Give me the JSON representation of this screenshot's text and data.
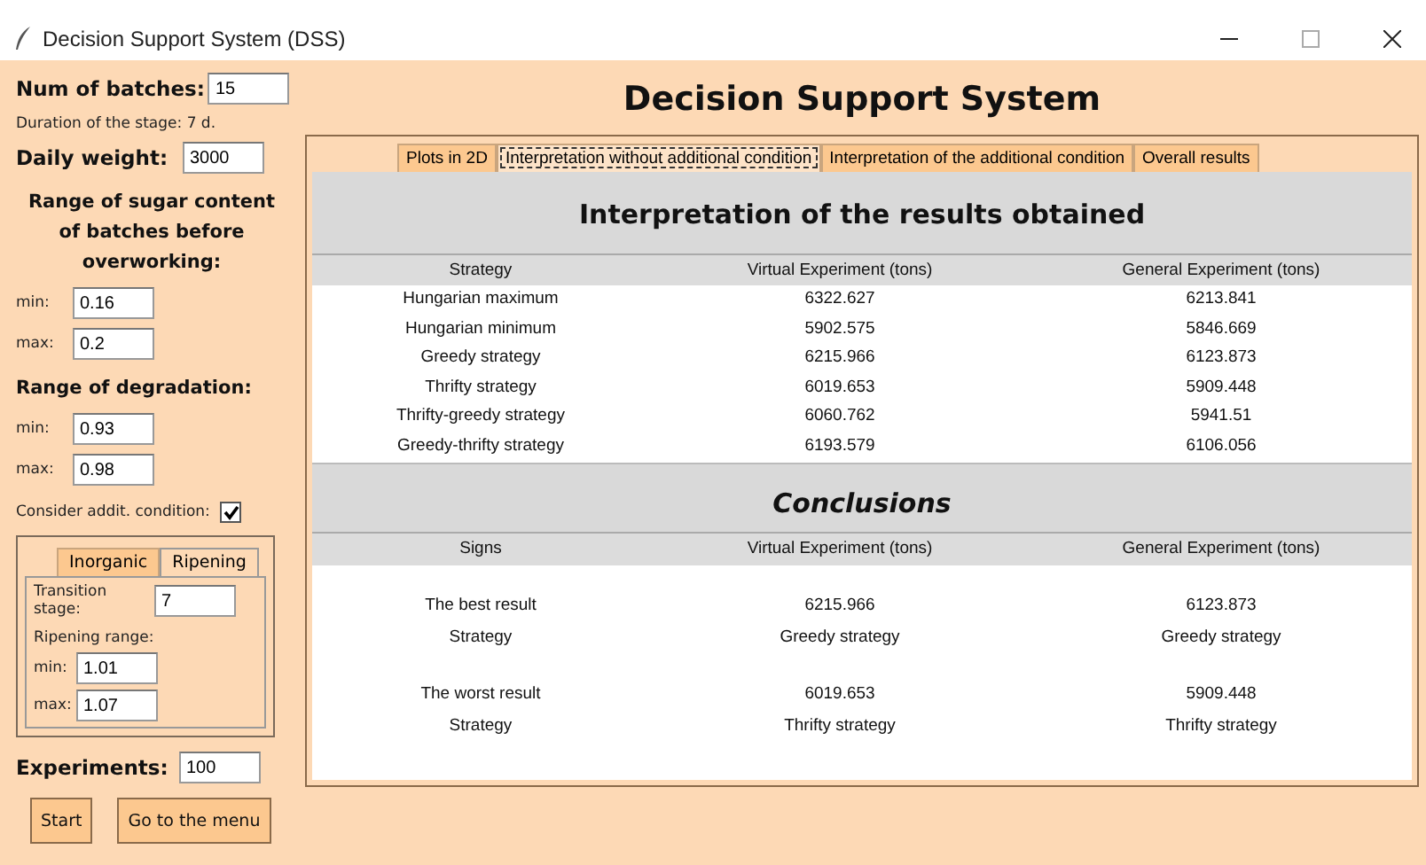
{
  "window": {
    "title": "Decision Support System (DSS)"
  },
  "settings": {
    "batches": {
      "label": "Num of batches:",
      "value": "15"
    },
    "duration": "Duration of the stage: 7 d.",
    "daily_weight": {
      "label": "Daily weight:",
      "value": "3000"
    },
    "sugar_range": {
      "heading": "Range of sugar content of batches before overworking:",
      "min": {
        "label": "min:",
        "value": "0.16"
      },
      "max": {
        "label": "max:",
        "value": "0.2"
      }
    },
    "degradation": {
      "heading": "Range of degradation:",
      "min": {
        "label": "min:",
        "value": "0.93"
      },
      "max": {
        "label": "max:",
        "value": "0.98"
      }
    },
    "consider": {
      "label": "Consider addit. condition:",
      "checked": true
    },
    "condition_tabs": [
      {
        "label": "Inorganic",
        "selected": false
      },
      {
        "label": "Ripening",
        "selected": true
      }
    ],
    "ripening": {
      "transition": {
        "label": "Transition stage:",
        "value": "7"
      },
      "range_label": "Ripening range:",
      "min": {
        "label": "min:",
        "value": "1.01"
      },
      "max": {
        "label": "max:",
        "value": "1.07"
      }
    },
    "experiments": {
      "label": "Experiments:",
      "value": "100"
    },
    "buttons": [
      "Start",
      "Go to the menu"
    ]
  },
  "main": {
    "title": "Decision Support System",
    "tabs": [
      {
        "label": "Plots in 2D",
        "selected": false
      },
      {
        "label": "Interpretation without additional condition",
        "selected": true
      },
      {
        "label": "Interpretation of the additional condition",
        "selected": false
      },
      {
        "label": "Overall results",
        "selected": false
      }
    ],
    "results": {
      "title": "Interpretation of the results obtained",
      "columns": [
        "Strategy",
        "Virtual Experiment (tons)",
        "General Experiment (tons)"
      ],
      "rows": [
        [
          "Hungarian maximum",
          "6322.627",
          "6213.841"
        ],
        [
          "Hungarian minimum",
          "5902.575",
          "5846.669"
        ],
        [
          "Greedy strategy",
          "6215.966",
          "6123.873"
        ],
        [
          "Thrifty strategy",
          "6019.653",
          "5909.448"
        ],
        [
          "Thrifty-greedy strategy",
          "6060.762",
          "5941.51"
        ],
        [
          "Greedy-thrifty strategy",
          "6193.579",
          "6106.056"
        ]
      ]
    },
    "conclusions": {
      "title": "Conclusions",
      "columns": [
        "Signs",
        "Virtual Experiment (tons)",
        "General Experiment (tons)"
      ],
      "groups": [
        {
          "rows": [
            [
              "The best result",
              "6215.966",
              "6123.873"
            ],
            [
              "Strategy",
              "Greedy strategy",
              "Greedy strategy"
            ]
          ]
        },
        {
          "rows": [
            [
              "The worst result",
              "6019.653",
              "5909.448"
            ],
            [
              "Strategy",
              "Thrifty strategy",
              "Thrifty strategy"
            ]
          ]
        }
      ]
    }
  }
}
